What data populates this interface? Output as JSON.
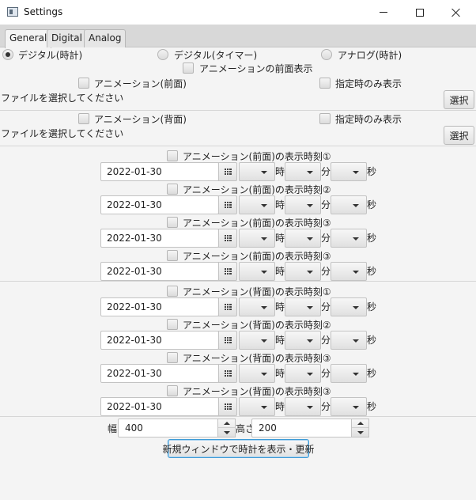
{
  "window": {
    "title": "Settings",
    "icon": "app-window-icon"
  },
  "tabs": [
    {
      "label": "General",
      "active": true
    },
    {
      "label": "Digital",
      "active": false
    },
    {
      "label": "Analog",
      "active": false
    }
  ],
  "mode_radios": {
    "digital_clock": {
      "label": "デジタル(時計)",
      "selected": true
    },
    "digital_timer": {
      "label": "デジタル(タイマー)",
      "selected": false
    },
    "analog_clock": {
      "label": "アナログ(時計)",
      "selected": false
    }
  },
  "front_display_label": "アニメーションの前面表示",
  "front_anim": {
    "label": "アニメーション(前面)",
    "specified_time_label": "指定時のみ表示",
    "file_prompt": "ファイルを選択してください",
    "select_button": "選択"
  },
  "back_anim": {
    "label": "アニメーション(背面)",
    "specified_time_label": "指定時のみ表示",
    "file_prompt": "ファイルを選択してください",
    "select_button": "選択"
  },
  "unit_labels": {
    "hour": "時",
    "minute": "分",
    "second": "秒"
  },
  "time_entries": [
    {
      "label": "アニメーション(前面)の表示時刻①",
      "date": "2022-01-30"
    },
    {
      "label": "アニメーション(前面)の表示時刻②",
      "date": "2022-01-30"
    },
    {
      "label": "アニメーション(前面)の表示時刻③",
      "date": "2022-01-30"
    },
    {
      "label": "アニメーション(前面)の表示時刻③",
      "date": "2022-01-30"
    },
    {
      "label": "アニメーション(背面)の表示時刻①",
      "date": "2022-01-30"
    },
    {
      "label": "アニメーション(背面)の表示時刻②",
      "date": "2022-01-30"
    },
    {
      "label": "アニメーション(背面)の表示時刻③",
      "date": "2022-01-30"
    },
    {
      "label": "アニメーション(背面)の表示時刻③",
      "date": "2022-01-30"
    }
  ],
  "size": {
    "width_label": "幅",
    "width_value": "400",
    "height_label": "高さ",
    "height_value": "200"
  },
  "apply_button": "新規ウィンドウで時計を表示・更新",
  "colors": {
    "focus_border": "#3d9ad6",
    "window_bg": "#f4f4f4",
    "titlebar_bg": "#ffffff"
  }
}
